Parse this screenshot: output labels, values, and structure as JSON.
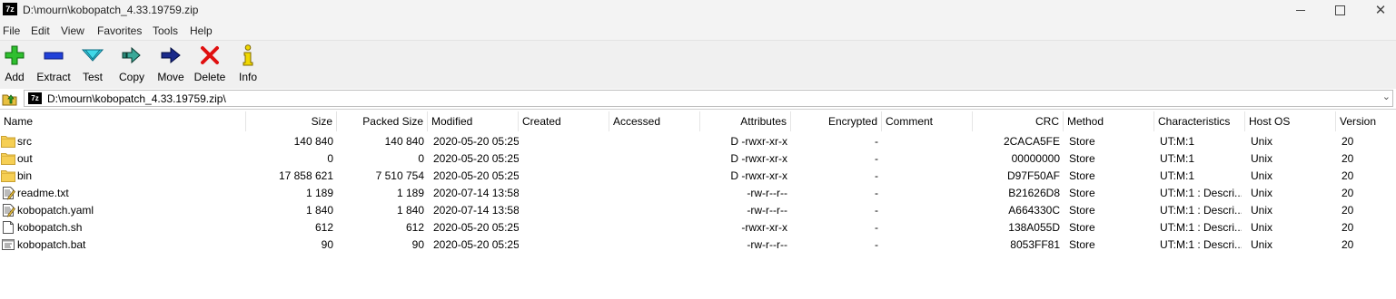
{
  "window": {
    "title": "D:\\mourn\\kobopatch_4.33.19759.zip",
    "app_icon_text": "7z",
    "close_glyph": "✕"
  },
  "menu": [
    "File",
    "Edit",
    "View",
    "Favorites",
    "Tools",
    "Help"
  ],
  "toolbar": [
    {
      "label": "Add",
      "icon": "add-icon"
    },
    {
      "label": "Extract",
      "icon": "extract-icon"
    },
    {
      "label": "Test",
      "icon": "test-icon"
    },
    {
      "label": "Copy",
      "icon": "copy-icon"
    },
    {
      "label": "Move",
      "icon": "move-icon"
    },
    {
      "label": "Delete",
      "icon": "delete-icon"
    },
    {
      "label": "Info",
      "icon": "info-icon"
    }
  ],
  "address": {
    "path": "D:\\mourn\\kobopatch_4.33.19759.zip\\",
    "icon_text": "7z"
  },
  "columns": [
    "Name",
    "Size",
    "Packed Size",
    "Modified",
    "Created",
    "Accessed",
    "Attributes",
    "Encrypted",
    "Comment",
    "CRC",
    "Method",
    "Characteristics",
    "Host OS",
    "Version"
  ],
  "rows": [
    {
      "icon": "folder-icon",
      "name": "src",
      "size": "140 840",
      "packed": "140 840",
      "modified": "2020-05-20 05:25",
      "created": "",
      "accessed": "",
      "attributes": "D -rwxr-xr-x",
      "encrypted": "-",
      "comment": "",
      "crc": "2CACA5FE",
      "method": "Store",
      "characteristics": "UT:M:1",
      "host_os": "Unix",
      "version": "20"
    },
    {
      "icon": "folder-icon",
      "name": "out",
      "size": "0",
      "packed": "0",
      "modified": "2020-05-20 05:25",
      "created": "",
      "accessed": "",
      "attributes": "D -rwxr-xr-x",
      "encrypted": "-",
      "comment": "",
      "crc": "00000000",
      "method": "Store",
      "characteristics": "UT:M:1",
      "host_os": "Unix",
      "version": "20"
    },
    {
      "icon": "folder-icon",
      "name": "bin",
      "size": "17 858 621",
      "packed": "7 510 754",
      "modified": "2020-05-20 05:25",
      "created": "",
      "accessed": "",
      "attributes": "D -rwxr-xr-x",
      "encrypted": "-",
      "comment": "",
      "crc": "D97F50AF",
      "method": "Store",
      "characteristics": "UT:M:1",
      "host_os": "Unix",
      "version": "20"
    },
    {
      "icon": "text-file-icon",
      "name": "readme.txt",
      "size": "1 189",
      "packed": "1 189",
      "modified": "2020-07-14 13:58",
      "created": "",
      "accessed": "",
      "attributes": "-rw-r--r--",
      "encrypted": "-",
      "comment": "",
      "crc": "B21626D8",
      "method": "Store",
      "characteristics": "UT:M:1 : Descri...",
      "host_os": "Unix",
      "version": "20"
    },
    {
      "icon": "text-file-icon",
      "name": "kobopatch.yaml",
      "size": "1 840",
      "packed": "1 840",
      "modified": "2020-07-14 13:58",
      "created": "",
      "accessed": "",
      "attributes": "-rw-r--r--",
      "encrypted": "-",
      "comment": "",
      "crc": "A664330C",
      "method": "Store",
      "characteristics": "UT:M:1 : Descri...",
      "host_os": "Unix",
      "version": "20"
    },
    {
      "icon": "blank-file-icon",
      "name": "kobopatch.sh",
      "size": "612",
      "packed": "612",
      "modified": "2020-05-20 05:25",
      "created": "",
      "accessed": "",
      "attributes": "-rwxr-xr-x",
      "encrypted": "-",
      "comment": "",
      "crc": "138A055D",
      "method": "Store",
      "characteristics": "UT:M:1 : Descri...",
      "host_os": "Unix",
      "version": "20"
    },
    {
      "icon": "batch-file-icon",
      "name": "kobopatch.bat",
      "size": "90",
      "packed": "90",
      "modified": "2020-05-20 05:25",
      "created": "",
      "accessed": "",
      "attributes": "-rw-r--r--",
      "encrypted": "-",
      "comment": "",
      "crc": "8053FF81",
      "method": "Store",
      "characteristics": "UT:M:1 : Descri...",
      "host_os": "Unix",
      "version": "20"
    }
  ]
}
